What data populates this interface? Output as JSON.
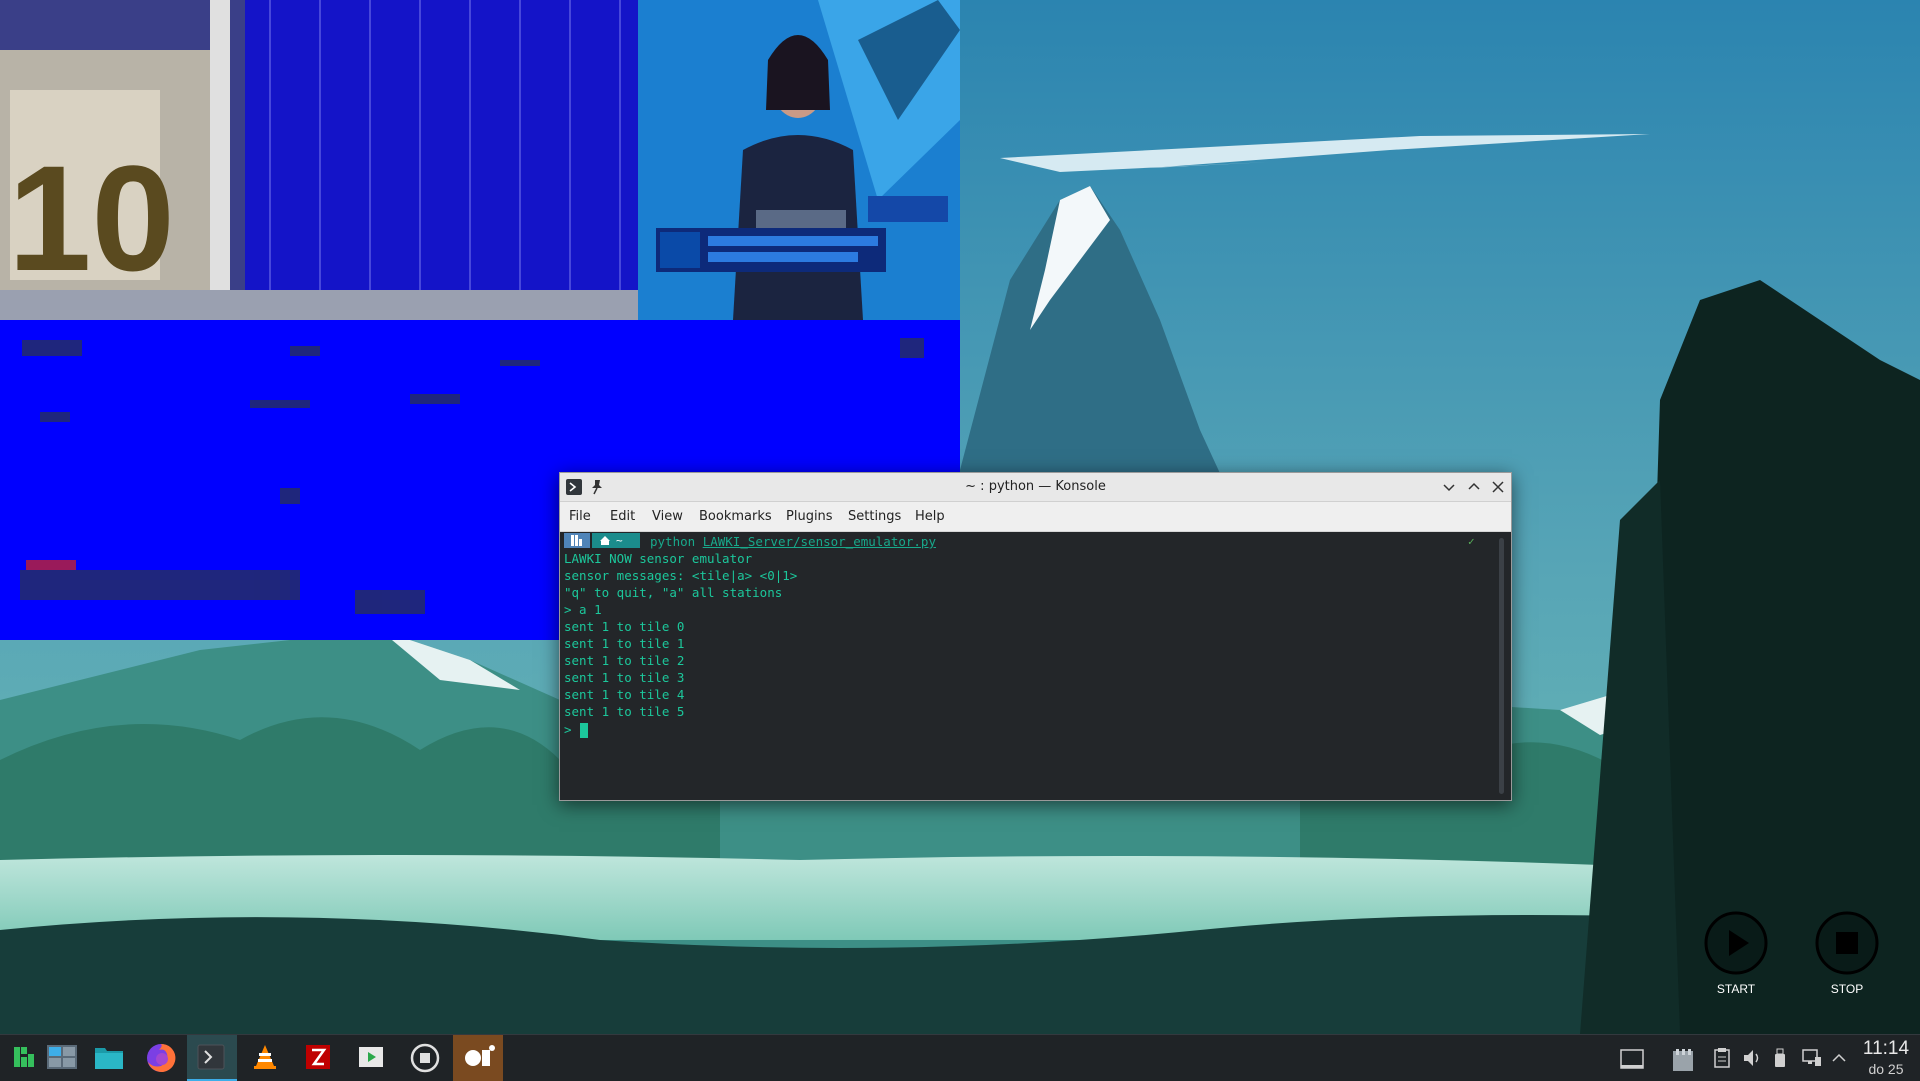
{
  "konsole": {
    "title": "~ : python — Konsole",
    "menu": [
      "File",
      "Edit",
      "View",
      "Bookmarks",
      "Plugins",
      "Settings",
      "Help"
    ],
    "prompt_dir": "~",
    "command_name": "python",
    "command_arg": "LAWKI_Server/sensor_emulator.py",
    "output": [
      "LAWKI NOW sensor emulator",
      "sensor messages: <tile|a> <0|1>",
      "\"q\" to quit, \"a\" all stations",
      "> a 1",
      "sent 1 to tile 0",
      "sent 1 to tile 1",
      "sent 1 to tile 2",
      "sent 1 to tile 3",
      "sent 1 to tile 4",
      "sent 1 to tile 5"
    ],
    "input_prompt": ">"
  },
  "controls": {
    "start_label": "START",
    "stop_label": "STOP"
  },
  "taskbar": {
    "items": [
      {
        "name": "application-launcher-icon"
      },
      {
        "name": "pager-icon"
      },
      {
        "name": "file-manager-icon"
      },
      {
        "name": "firefox-icon"
      },
      {
        "name": "konsole-icon"
      },
      {
        "name": "vlc-icon"
      },
      {
        "name": "filezilla-icon"
      },
      {
        "name": "media-player-icon"
      },
      {
        "name": "record-stop-icon"
      },
      {
        "name": "obs-icon"
      }
    ],
    "clock_time": "11:14",
    "clock_date": "do 25"
  },
  "colors": {
    "terminal_text": "#1cc79b",
    "terminal_bg": "#232629",
    "taskbar_bg": "#1f2326",
    "accent": "#3daee9",
    "tile_blue": "#0000ff"
  }
}
